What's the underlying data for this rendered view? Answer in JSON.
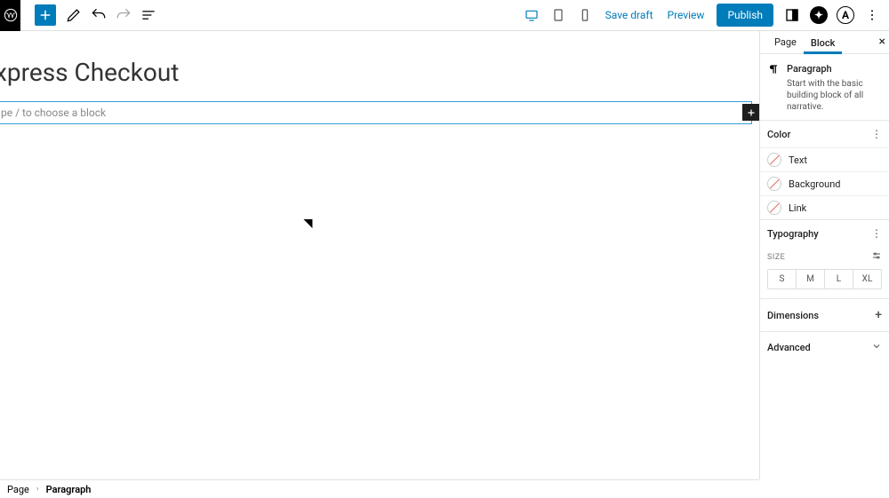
{
  "toolbar": {
    "save_draft": "Save draft",
    "preview": "Preview",
    "publish": "Publish"
  },
  "editor": {
    "title": "xpress Checkout",
    "placeholder": "pe / to choose a block"
  },
  "sidebar": {
    "tabs": {
      "page": "Page",
      "block": "Block"
    },
    "header": {
      "title": "Paragraph",
      "desc": "Start with the basic building block of all narrative."
    },
    "sections": {
      "color": {
        "title": "Color",
        "options": [
          "Text",
          "Background",
          "Link"
        ]
      },
      "typography": {
        "title": "Typography",
        "size_label": "SIZE",
        "sizes": [
          "S",
          "M",
          "L",
          "XL"
        ]
      },
      "dimensions": "Dimensions",
      "advanced": "Advanced"
    }
  },
  "breadcrumb": {
    "root": "Page",
    "current": "Paragraph"
  }
}
